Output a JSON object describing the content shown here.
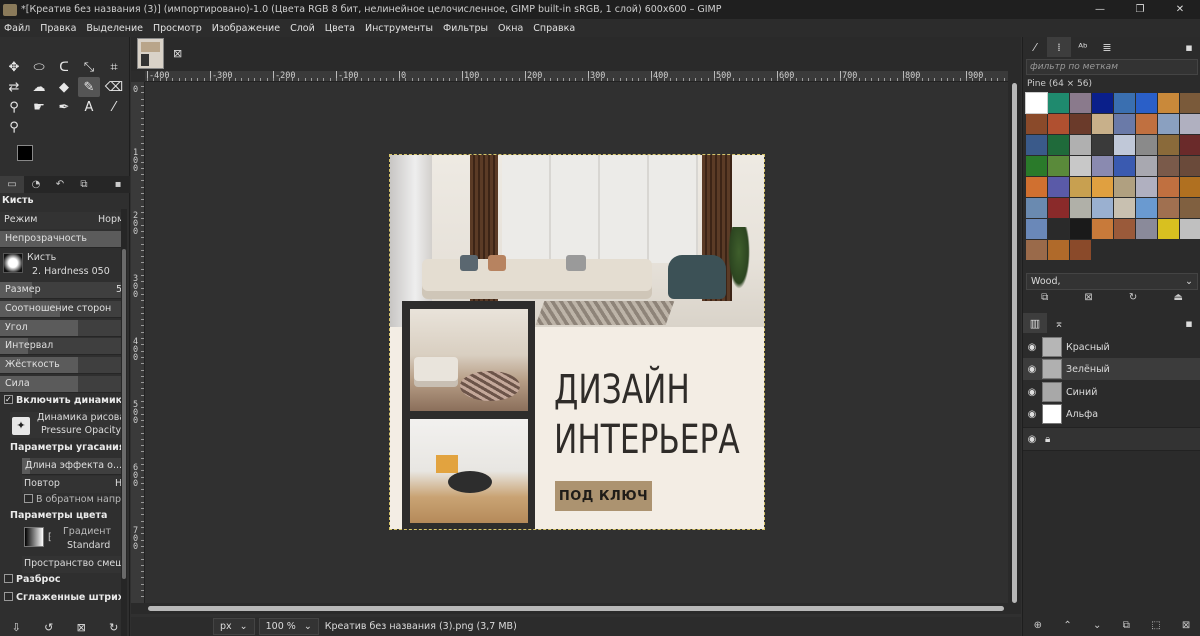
{
  "window": {
    "title": "*[Креатив без названия (3)] (импортировано)-1.0 (Цвета RGB 8 бит, нелинейное целочисленное, GIMP built-in sRGB, 1 слой) 600x600 – GIMP",
    "controls": [
      "—",
      "❐",
      "✕"
    ]
  },
  "menu": [
    "Файл",
    "Правка",
    "Выделение",
    "Просмотр",
    "Изображение",
    "Слой",
    "Цвета",
    "Инструменты",
    "Фильтры",
    "Окна",
    "Справка"
  ],
  "toolbox": {
    "tool_icons": [
      "move-icon",
      "rect-select-icon",
      "lasso-icon",
      "fuzzy-select-icon",
      "crop-icon",
      "transform-icon",
      "warp-icon",
      "bucket-icon",
      "paintbrush-icon",
      "eraser-icon",
      "clone-icon",
      "smudge-icon",
      "path-icon",
      "text-icon",
      "color-picker-icon",
      "zoom-icon"
    ],
    "options": {
      "section_title": "Кисть",
      "mode_label": "Режим",
      "mode_value": "Норм",
      "opacity_label": "Непрозрачность",
      "opacity_value": 1.0,
      "brush_label": "Кисть",
      "brush_name": "2. Hardness 050",
      "size_label": "Размер",
      "size_value": "5",
      "aspect_label": "Соотношение сторон",
      "angle_label": "Угол",
      "spacing_label": "Интервал",
      "hardness_label": "Жёсткость",
      "force_label": "Сила",
      "dynamics_toggle": "Включить динамику",
      "dynamics_label": "Динамика рисован",
      "dynamics_value": "Pressure Opacity",
      "fade_title": "Параметры угасания",
      "fade_length": "Длина эффекта о...",
      "repeat_label": "Повтор",
      "repeat_value": "Н",
      "reverse_label": "В обратном напра",
      "color_title": "Параметры цвета",
      "gradient_label": "Градиент",
      "gradient_value": "Standard",
      "blend_space": "Пространство смешен",
      "scatter": "Разброс",
      "smooth": "Сглаженные штрихи"
    }
  },
  "ruler": {
    "h_labels": [
      "-400",
      "-300",
      "-200",
      "-100",
      "0",
      "100",
      "200",
      "300",
      "400",
      "500",
      "600",
      "700",
      "800",
      "900"
    ],
    "v_labels": [
      "0",
      "1 0 0",
      "2 0 0",
      "3 0 0",
      "4 0 0",
      "5 0 0",
      "6 0 0",
      "7 0 0"
    ]
  },
  "artwork": {
    "headline_line1": "ДИЗАЙН",
    "headline_line2": "ИНТЕРЬЕРА",
    "cta": "ПОД КЛЮЧ"
  },
  "status": {
    "unit": "px",
    "zoom": "100 %",
    "file": "Креатив без названия (3).png (3,7 MB)"
  },
  "dock": {
    "filter_placeholder": "фильтр по меткам",
    "pattern_title": "Pine (64 × 56)",
    "pattern_colors": [
      "#ffffff",
      "#1f8a6e",
      "#8a7a8c",
      "#0a1f8a",
      "#3a6fb0",
      "#2a5fc8",
      "#c9893a",
      "#7a5a3a",
      "#8a4a2a",
      "#b05030",
      "#6a3a2a",
      "#c8b08a",
      "#6a7aa8",
      "#c07040",
      "#8aa0c0",
      "#b0b0c0",
      "#3a5a8a",
      "#1f6a3a",
      "#b0b0b0",
      "#3a3a3a",
      "#c0c8d8",
      "#8a8a8a",
      "#8a6a3a",
      "#6a2a2a",
      "#2a7a2a",
      "#5a8a3a",
      "#c8c8c8",
      "#8a8ab0",
      "#3a5ab0",
      "#a8a8b0",
      "#7a5a4a",
      "#6a4a3a",
      "#d07030",
      "#5a5aa8",
      "#c8a050",
      "#e0a040",
      "#b0a080",
      "#b0b0c0",
      "#c07040",
      "#b07020",
      "#6a8ab0",
      "#8a2a2a",
      "#b0b0a8",
      "#9ab0d0",
      "#c8c0b0",
      "#6a9ad0",
      "#a07050",
      "#806040",
      "#6a88b8",
      "#2a2a2a",
      "#1a1a1a",
      "#c87a3a",
      "#9a5a3a",
      "#8a8a9a",
      "#d8c020",
      "#c0c0c0",
      "#9a6a4a",
      "#b06a2a",
      "#8a4a2a"
    ],
    "selected_pattern": "Wood,",
    "layers": [
      {
        "name": "Красный",
        "selected": false
      },
      {
        "name": "Зелёный",
        "selected": true
      },
      {
        "name": "Синий",
        "selected": false
      },
      {
        "name": "Альфа",
        "selected": false
      }
    ]
  }
}
